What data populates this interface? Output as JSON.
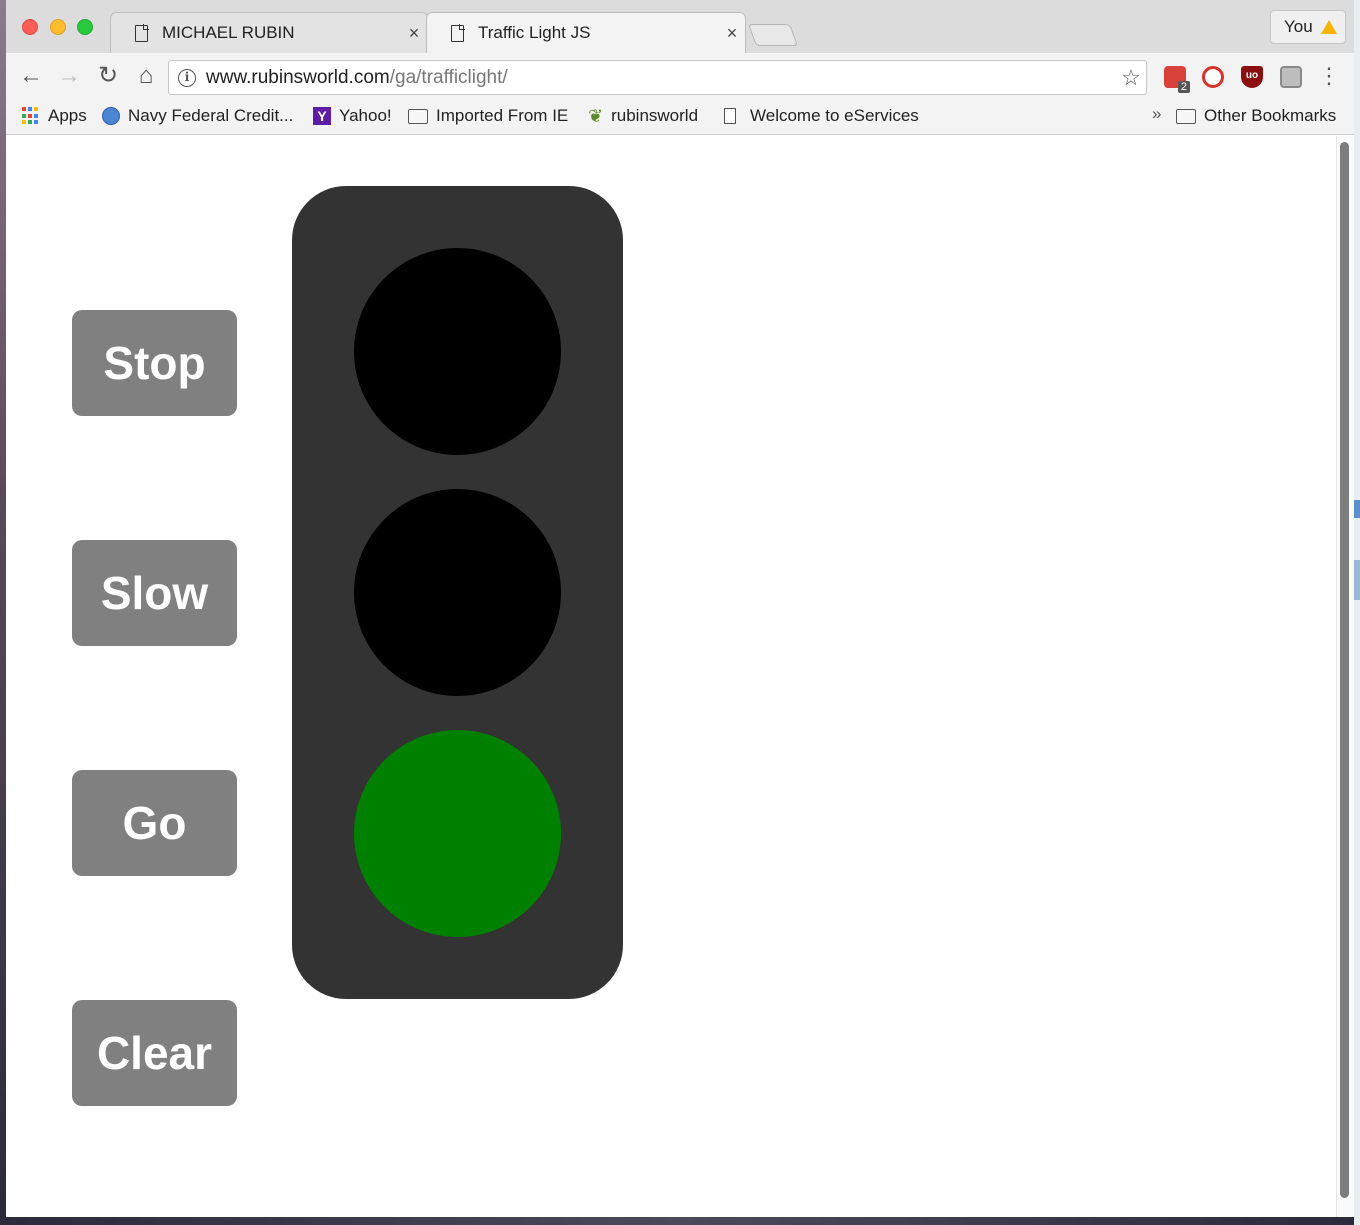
{
  "browser": {
    "tabs": [
      {
        "title": "MICHAEL RUBIN",
        "close": "×"
      },
      {
        "title": "Traffic Light JS",
        "close": "×"
      }
    ],
    "profile_label": "You",
    "address": {
      "host": "www.rubinsworld.com",
      "path": "/ga/trafficlight/"
    },
    "nav": {
      "back": "←",
      "forward": "→",
      "reload": "↻",
      "home": "⌂",
      "star": "☆",
      "menu": "⋮"
    },
    "extension_badge": "2",
    "extension_ublock_text": "uo",
    "bookmarks": [
      {
        "label": "Apps",
        "icon": "apps-grid-icon"
      },
      {
        "label": "Navy Federal Credit...",
        "icon": "globe-icon"
      },
      {
        "label": "Yahoo!",
        "icon": "yahoo-icon"
      },
      {
        "label": "Imported From IE",
        "icon": "folder-icon"
      },
      {
        "label": "rubinsworld",
        "icon": "leaf-icon"
      },
      {
        "label": "Welcome to eServices",
        "icon": "document-icon"
      }
    ],
    "bookmarks_overflow": "»",
    "other_bookmarks": "Other Bookmarks",
    "yahoo_glyph": "Y"
  },
  "page": {
    "buttons": {
      "stop": "Stop",
      "slow": "Slow",
      "go": "Go",
      "clear": "Clear"
    },
    "traffic_light": {
      "housing_color": "#333333",
      "lamps": [
        {
          "name": "red",
          "state": "off",
          "color": "#000000"
        },
        {
          "name": "yellow",
          "state": "off",
          "color": "#000000"
        },
        {
          "name": "green",
          "state": "on",
          "color": "#008000"
        }
      ]
    },
    "button_color": "#808080"
  }
}
